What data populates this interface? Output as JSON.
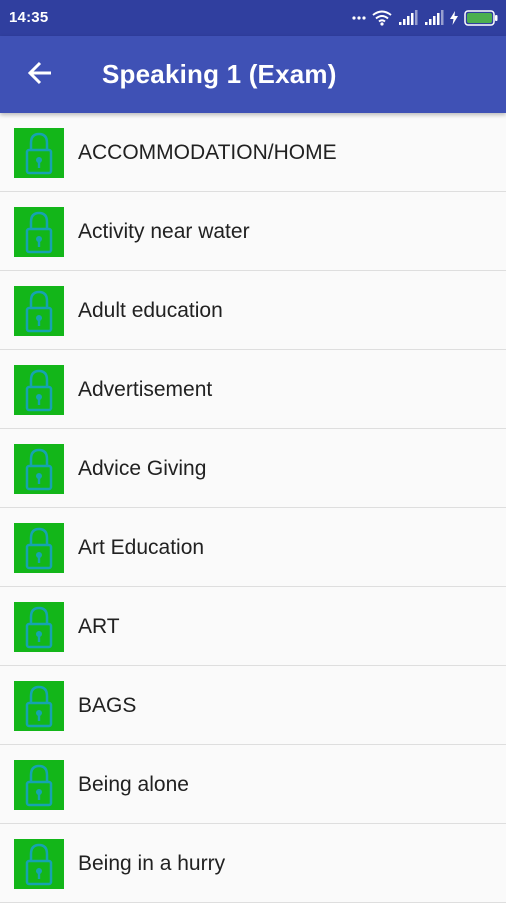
{
  "status_bar": {
    "time": "14:35",
    "icons": [
      "more-dots-icon",
      "wifi-icon",
      "signal-icon",
      "signal-icon",
      "charging-icon",
      "battery-icon"
    ],
    "battery_color": "#4caf50"
  },
  "app_bar": {
    "title": "Speaking 1 (Exam)",
    "back_icon": "arrow-back-icon",
    "color": "#3f51b5"
  },
  "topics": {
    "thumb_icon": "padlock-icon",
    "thumb_color": "#13b619",
    "items": [
      {
        "label": "ACCOMMODATION/HOME"
      },
      {
        "label": "Activity near water"
      },
      {
        "label": "Adult education"
      },
      {
        "label": "Advertisement"
      },
      {
        "label": "Advice Giving"
      },
      {
        "label": "Art Education"
      },
      {
        "label": "ART"
      },
      {
        "label": "BAGS"
      },
      {
        "label": "Being alone"
      },
      {
        "label": "Being in a hurry"
      }
    ]
  }
}
